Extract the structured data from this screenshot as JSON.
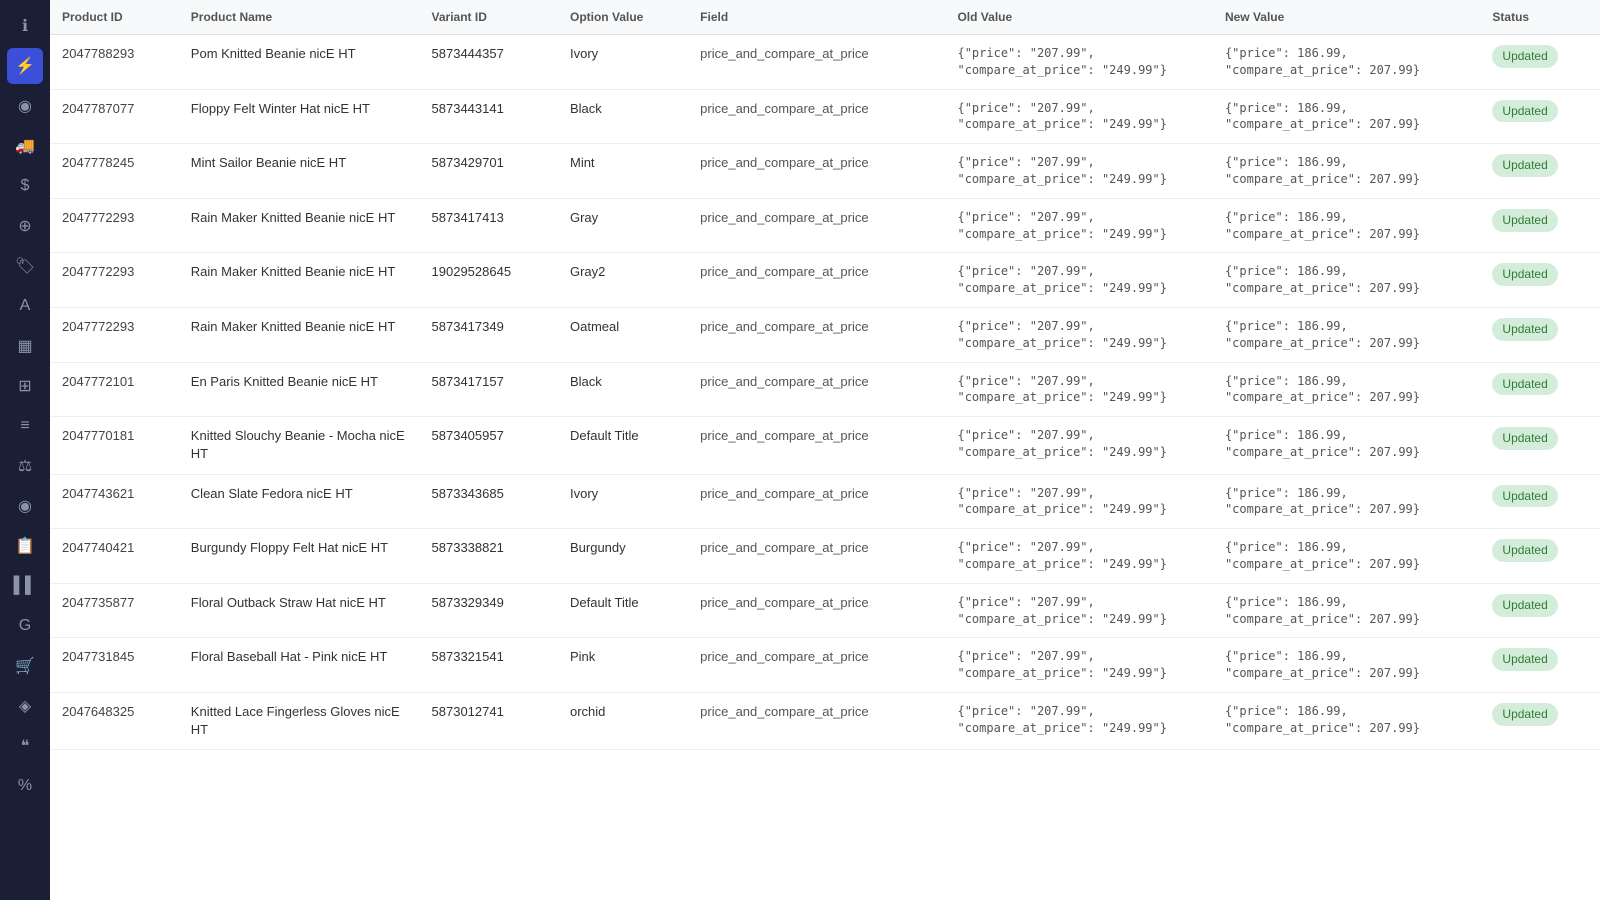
{
  "sidebar": {
    "icons": [
      {
        "name": "info-icon",
        "symbol": "ℹ",
        "active": false
      },
      {
        "name": "bolt-icon",
        "symbol": "⚡",
        "active": true
      },
      {
        "name": "circle-icon",
        "symbol": "◉",
        "active": false
      },
      {
        "name": "truck-icon",
        "symbol": "🚚",
        "active": false
      },
      {
        "name": "dollar-icon",
        "symbol": "$",
        "active": false
      },
      {
        "name": "tag2-icon",
        "symbol": "⊕",
        "active": false
      },
      {
        "name": "tag-icon",
        "symbol": "🏷",
        "active": false
      },
      {
        "name": "text-icon",
        "symbol": "A",
        "active": false
      },
      {
        "name": "grid2-icon",
        "symbol": "▦",
        "active": false
      },
      {
        "name": "grid-icon",
        "symbol": "⊞",
        "active": false
      },
      {
        "name": "list-icon",
        "symbol": "≡",
        "active": false
      },
      {
        "name": "balance-icon",
        "symbol": "⚖",
        "active": false
      },
      {
        "name": "eye-icon",
        "symbol": "◉",
        "active": false
      },
      {
        "name": "note-icon",
        "symbol": "📋",
        "active": false
      },
      {
        "name": "barcode-icon",
        "symbol": "▌▌",
        "active": false
      },
      {
        "name": "g-icon",
        "symbol": "G",
        "active": false
      },
      {
        "name": "cart-icon",
        "symbol": "🛒",
        "active": false
      },
      {
        "name": "layer-icon",
        "symbol": "◈",
        "active": false
      },
      {
        "name": "quote-icon",
        "symbol": "❝",
        "active": false
      },
      {
        "name": "percent-icon",
        "symbol": "%",
        "active": false
      }
    ]
  },
  "table": {
    "columns": [
      "Product ID",
      "Product Name",
      "Variant ID",
      "Option Value",
      "Field",
      "Old Value",
      "New Value",
      "Status"
    ],
    "rows": [
      {
        "product_id": "2047788293",
        "product_name": "Pom Knitted Beanie nicE HT",
        "variant_id": "5873444357",
        "option_value": "Ivory",
        "field": "price_and_compare_at_price",
        "old_value": "{\"price\": \"207.99\",\n\"compare_at_price\": \"249.99\"}",
        "new_value": "{\"price\": 186.99,\n\"compare_at_price\": 207.99}",
        "status": "Updated"
      },
      {
        "product_id": "2047787077",
        "product_name": "Floppy Felt Winter Hat nicE HT",
        "variant_id": "5873443141",
        "option_value": "Black",
        "field": "price_and_compare_at_price",
        "old_value": "{\"price\": \"207.99\",\n\"compare_at_price\": \"249.99\"}",
        "new_value": "{\"price\": 186.99,\n\"compare_at_price\": 207.99}",
        "status": "Updated"
      },
      {
        "product_id": "2047778245",
        "product_name": "Mint Sailor Beanie nicE HT",
        "variant_id": "5873429701",
        "option_value": "Mint",
        "field": "price_and_compare_at_price",
        "old_value": "{\"price\": \"207.99\",\n\"compare_at_price\": \"249.99\"}",
        "new_value": "{\"price\": 186.99,\n\"compare_at_price\": 207.99}",
        "status": "Updated"
      },
      {
        "product_id": "2047772293",
        "product_name": "Rain Maker Knitted Beanie nicE HT",
        "variant_id": "5873417413",
        "option_value": "Gray",
        "field": "price_and_compare_at_price",
        "old_value": "{\"price\": \"207.99\",\n\"compare_at_price\": \"249.99\"}",
        "new_value": "{\"price\": 186.99,\n\"compare_at_price\": 207.99}",
        "status": "Updated"
      },
      {
        "product_id": "2047772293",
        "product_name": "Rain Maker Knitted Beanie nicE HT",
        "variant_id": "19029528645",
        "option_value": "Gray2",
        "field": "price_and_compare_at_price",
        "old_value": "{\"price\": \"207.99\",\n\"compare_at_price\": \"249.99\"}",
        "new_value": "{\"price\": 186.99,\n\"compare_at_price\": 207.99}",
        "status": "Updated"
      },
      {
        "product_id": "2047772293",
        "product_name": "Rain Maker Knitted Beanie nicE HT",
        "variant_id": "5873417349",
        "option_value": "Oatmeal",
        "field": "price_and_compare_at_price",
        "old_value": "{\"price\": \"207.99\",\n\"compare_at_price\": \"249.99\"}",
        "new_value": "{\"price\": 186.99,\n\"compare_at_price\": 207.99}",
        "status": "Updated"
      },
      {
        "product_id": "2047772101",
        "product_name": "En Paris Knitted Beanie nicE HT",
        "variant_id": "5873417157",
        "option_value": "Black",
        "field": "price_and_compare_at_price",
        "old_value": "{\"price\": \"207.99\",\n\"compare_at_price\": \"249.99\"}",
        "new_value": "{\"price\": 186.99,\n\"compare_at_price\": 207.99}",
        "status": "Updated"
      },
      {
        "product_id": "2047770181",
        "product_name": "Knitted Slouchy Beanie - Mocha nicE HT",
        "variant_id": "5873405957",
        "option_value": "Default Title",
        "field": "price_and_compare_at_price",
        "old_value": "{\"price\": \"207.99\",\n\"compare_at_price\": \"249.99\"}",
        "new_value": "{\"price\": 186.99,\n\"compare_at_price\": 207.99}",
        "status": "Updated"
      },
      {
        "product_id": "2047743621",
        "product_name": "Clean Slate Fedora nicE HT",
        "variant_id": "5873343685",
        "option_value": "Ivory",
        "field": "price_and_compare_at_price",
        "old_value": "{\"price\": \"207.99\",\n\"compare_at_price\": \"249.99\"}",
        "new_value": "{\"price\": 186.99,\n\"compare_at_price\": 207.99}",
        "status": "Updated"
      },
      {
        "product_id": "2047740421",
        "product_name": "Burgundy Floppy Felt Hat nicE HT",
        "variant_id": "5873338821",
        "option_value": "Burgundy",
        "field": "price_and_compare_at_price",
        "old_value": "{\"price\": \"207.99\",\n\"compare_at_price\": \"249.99\"}",
        "new_value": "{\"price\": 186.99,\n\"compare_at_price\": 207.99}",
        "status": "Updated"
      },
      {
        "product_id": "2047735877",
        "product_name": "Floral Outback Straw Hat nicE HT",
        "variant_id": "5873329349",
        "option_value": "Default Title",
        "field": "price_and_compare_at_price",
        "old_value": "{\"price\": \"207.99\",\n\"compare_at_price\": \"249.99\"}",
        "new_value": "{\"price\": 186.99,\n\"compare_at_price\": 207.99}",
        "status": "Updated"
      },
      {
        "product_id": "2047731845",
        "product_name": "Floral Baseball Hat - Pink nicE HT",
        "variant_id": "5873321541",
        "option_value": "Pink",
        "field": "price_and_compare_at_price",
        "old_value": "{\"price\": \"207.99\",\n\"compare_at_price\": \"249.99\"}",
        "new_value": "{\"price\": 186.99,\n\"compare_at_price\": 207.99}",
        "status": "Updated"
      },
      {
        "product_id": "2047648325",
        "product_name": "Knitted Lace Fingerless Gloves nicE HT",
        "variant_id": "5873012741",
        "option_value": "orchid",
        "field": "price_and_compare_at_price",
        "old_value": "{\"price\": \"207.99\",\n\"compare_at_price\": \"249.99\"}",
        "new_value": "{\"price\": 186.99,\n\"compare_at_price\": 207.99}",
        "status": "Updated"
      }
    ]
  }
}
